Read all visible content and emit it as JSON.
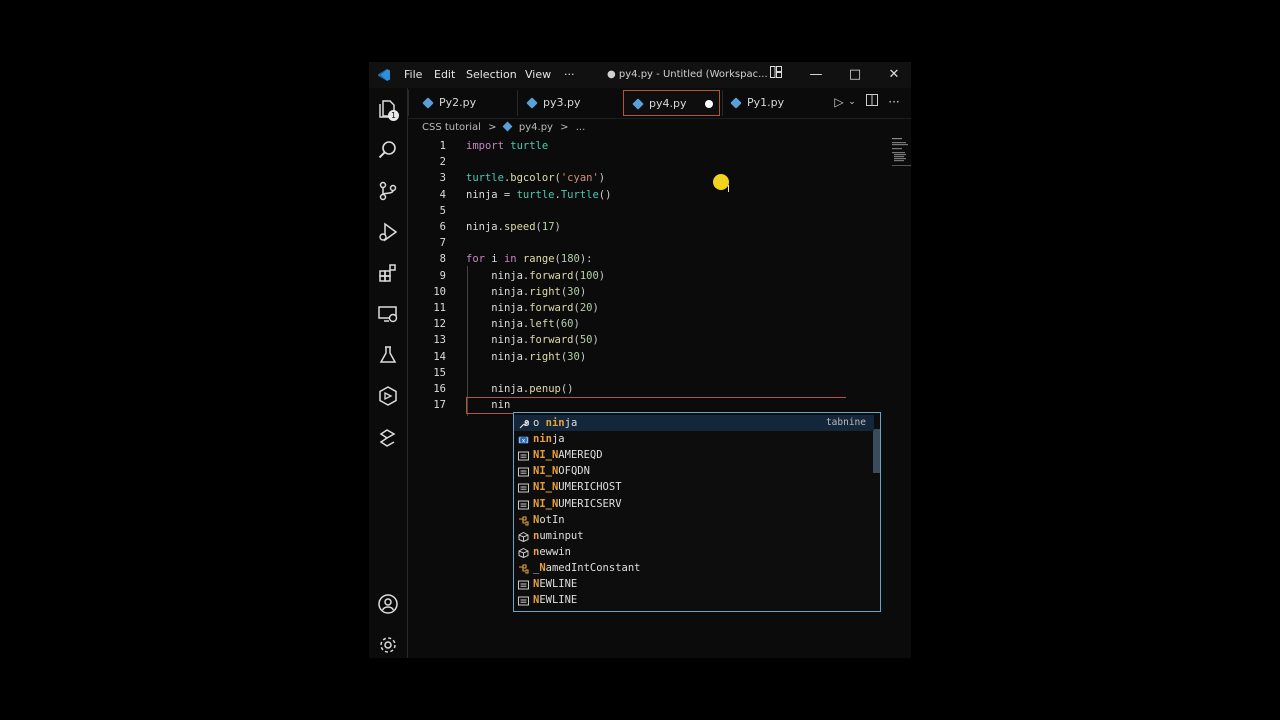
{
  "titlebar": {
    "menus": [
      "File",
      "Edit",
      "Selection",
      "View",
      "···"
    ],
    "title": "● py4.py - Untitled (Workspac...",
    "controls": [
      "layout-icon",
      "minimize-icon",
      "maximize-icon",
      "close-icon"
    ]
  },
  "activity": {
    "explorer_badge": "1",
    "items": [
      "files-icon",
      "search-icon",
      "source-control-icon",
      "run-debug-icon",
      "extensions-icon",
      "remote-explorer-icon",
      "testing-icon",
      "containers-icon",
      "pipelines-icon",
      "account-icon",
      "settings-gear-icon"
    ]
  },
  "tabs": [
    {
      "label": "Py2.py",
      "active": false
    },
    {
      "label": "py3.py",
      "active": false
    },
    {
      "label": "py4.py",
      "active": true,
      "dirty": true
    },
    {
      "label": "Py1.py",
      "active": false
    }
  ],
  "breadcrumb": [
    "CSS tutorial",
    ">",
    "py4.py",
    ">",
    "..."
  ],
  "editor": {
    "lines": [
      {
        "n": "1",
        "text": "import turtle"
      },
      {
        "n": "2",
        "text": ""
      },
      {
        "n": "3",
        "text": "turtle.bgcolor('cyan')"
      },
      {
        "n": "4",
        "text": "ninja = turtle.Turtle()"
      },
      {
        "n": "5",
        "text": ""
      },
      {
        "n": "6",
        "text": "ninja.speed(17)"
      },
      {
        "n": "7",
        "text": ""
      },
      {
        "n": "8",
        "text": "for i in range(180):"
      },
      {
        "n": "9",
        "text": "    ninja.forward(100)"
      },
      {
        "n": "10",
        "text": "    ninja.right(30)"
      },
      {
        "n": "11",
        "text": "    ninja.forward(20)"
      },
      {
        "n": "12",
        "text": "    ninja.left(60)"
      },
      {
        "n": "13",
        "text": "    ninja.forward(50)"
      },
      {
        "n": "14",
        "text": "    ninja.right(30)"
      },
      {
        "n": "15",
        "text": ""
      },
      {
        "n": "16",
        "text": "    ninja.penup()"
      },
      {
        "n": "17",
        "text": "    nin"
      }
    ]
  },
  "suggestions": {
    "source": "tabnine",
    "items": [
      {
        "icon": "wrench-icon",
        "pre": "o ",
        "match": "nin",
        "rest": "ja"
      },
      {
        "icon": "variable-icon",
        "pre": "",
        "match": "nin",
        "rest": "ja"
      },
      {
        "icon": "constant-icon",
        "pre": "",
        "match": "NI_N",
        "rest": "AMEREQD"
      },
      {
        "icon": "constant-icon",
        "pre": "",
        "match": "NI_N",
        "rest": "OFQDN"
      },
      {
        "icon": "constant-icon",
        "pre": "",
        "match": "NI_N",
        "rest": "UMERICHOST"
      },
      {
        "icon": "constant-icon",
        "pre": "",
        "match": "NI_N",
        "rest": "UMERICSERV"
      },
      {
        "icon": "class-icon",
        "pre": "",
        "match": "N",
        "rest": "otIn"
      },
      {
        "icon": "module-icon",
        "pre": "",
        "match": "n",
        "rest": "uminput"
      },
      {
        "icon": "module-icon",
        "pre": "",
        "match": "n",
        "rest": "ewwin"
      },
      {
        "icon": "class-icon",
        "pre": "_",
        "match": "N",
        "rest": "amedIntConstant"
      },
      {
        "icon": "constant-icon",
        "pre": "",
        "match": "N",
        "rest": "EWLINE"
      },
      {
        "icon": "constant-icon",
        "pre": "",
        "match": "N",
        "rest": "EWLINE"
      }
    ]
  }
}
